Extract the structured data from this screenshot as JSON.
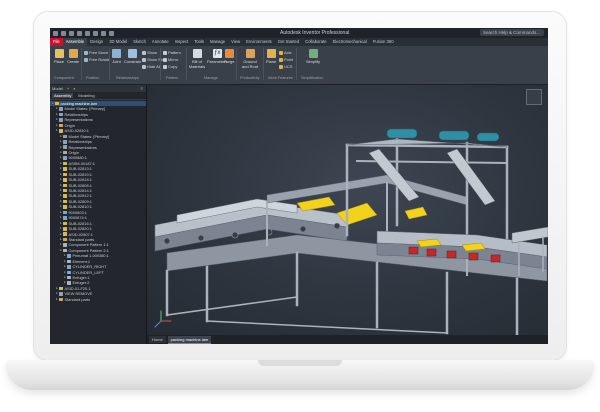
{
  "window": {
    "title": "Autodesk Inventor Professional",
    "search_placeholder": "Search Help & Commands..."
  },
  "tabs": [
    {
      "label": "File",
      "kind": "file"
    },
    {
      "label": "Assemble",
      "kind": "active"
    },
    {
      "label": "Design"
    },
    {
      "label": "3D Model"
    },
    {
      "label": "Sketch"
    },
    {
      "label": "Annotate"
    },
    {
      "label": "Inspect"
    },
    {
      "label": "Tools"
    },
    {
      "label": "Manage"
    },
    {
      "label": "View"
    },
    {
      "label": "Environments"
    },
    {
      "label": "Get Started"
    },
    {
      "label": "Collaborate"
    },
    {
      "label": "Electromechanical"
    },
    {
      "label": "Fusion 360"
    }
  ],
  "ribbon": {
    "buttons": {
      "place": "Place",
      "create": "Create",
      "joint": "Joint",
      "constrain": "Constrain",
      "bill_of_materials": "Bill of Materials",
      "parameters": "Parameters",
      "forge": "Forge",
      "ground_and_root": "Ground and Root",
      "plane": "Plane",
      "simplify": "Simplify"
    },
    "small": {
      "free_move": "Free Move",
      "free_rotate": "Free Rotate",
      "show": "Show",
      "show_sick": "Show Sick",
      "hide_all": "Hide All",
      "pattern": "Pattern",
      "mirror": "Mirror",
      "copy": "Copy",
      "axis": "Axis",
      "point": "Point",
      "ucs": "UCS"
    },
    "panels": {
      "component": "Component",
      "position": "Position",
      "relationships": "Relationships",
      "pattern": "Pattern",
      "manage": "Manage",
      "productivity": "Productivity",
      "work_features": "Work Features",
      "simplification": "Simplification"
    }
  },
  "browser": {
    "header": "Model",
    "tabs": [
      "Assembly",
      "Modeling"
    ],
    "items": [
      {
        "label": "packing machine.iam",
        "depth": 0,
        "sel": true,
        "c": "#d9b85c"
      },
      {
        "label": "Model States: [Primary]",
        "depth": 1,
        "c": "#8fa3b8"
      },
      {
        "label": "Relationships",
        "depth": 1,
        "c": "#8fa3b8"
      },
      {
        "label": "Representations",
        "depth": 1,
        "c": "#8fa3b8"
      },
      {
        "label": "Origin",
        "depth": 1,
        "c": "#c9a86a"
      },
      {
        "label": "ASID-02810:1",
        "depth": 1,
        "c": "#d9b85c"
      },
      {
        "label": "Model States: [Primary]",
        "depth": 2,
        "c": "#8fa3b8"
      },
      {
        "label": "Relationships",
        "depth": 2,
        "c": "#8fa3b8"
      },
      {
        "label": "Representations",
        "depth": 2,
        "c": "#8fa3b8"
      },
      {
        "label": "Origin",
        "depth": 2,
        "c": "#c9a86a"
      },
      {
        "label": "9000880:1",
        "depth": 2,
        "c": "#7aa7d8"
      },
      {
        "label": "ASSM-00187:1",
        "depth": 2,
        "c": "#d9b85c"
      },
      {
        "label": "SUB-02813:1",
        "depth": 2,
        "c": "#d9b85c"
      },
      {
        "label": "SUB-02819:1",
        "depth": 2,
        "c": "#d9b85c"
      },
      {
        "label": "SUB-02818:1",
        "depth": 2,
        "c": "#d9b85c"
      },
      {
        "label": "SUB-02808:1",
        "depth": 2,
        "c": "#d9b85c"
      },
      {
        "label": "SUB-02814:1",
        "depth": 2,
        "c": "#d9b85c"
      },
      {
        "label": "SUB-02812:1",
        "depth": 2,
        "c": "#d9b85c"
      },
      {
        "label": "SUB-02809:1",
        "depth": 2,
        "c": "#d9b85c"
      },
      {
        "label": "SUB-02810:1",
        "depth": 2,
        "c": "#d9b85c"
      },
      {
        "label": "9000803:1",
        "depth": 2,
        "c": "#7aa7d8"
      },
      {
        "label": "9000874:1",
        "depth": 2,
        "c": "#7aa7d8"
      },
      {
        "label": "SUB-02816:1",
        "depth": 2,
        "c": "#d9b85c"
      },
      {
        "label": "SUB-02820:1",
        "depth": 2,
        "c": "#d9b85c"
      },
      {
        "label": "ASID-02807:1",
        "depth": 2,
        "c": "#d9b85c"
      },
      {
        "label": "Standard parts",
        "depth": 2,
        "c": "#c9a86a"
      },
      {
        "label": "Component Pattern 1:1",
        "depth": 2,
        "c": "#a9b4c0"
      },
      {
        "label": "Component Pattern 2:1",
        "depth": 2,
        "c": "#a9b4c0"
      },
      {
        "label": "Pneumat 1-000380:1",
        "depth": 3,
        "c": "#7aa7d8"
      },
      {
        "label": "Element:1",
        "depth": 3,
        "c": "#a9b4c0"
      },
      {
        "label": "CYLINDER_RIGHT",
        "depth": 3,
        "c": "#7aa7d8"
      },
      {
        "label": "CYLINDER_LEFT",
        "depth": 3,
        "c": "#7aa7d8"
      },
      {
        "label": "Enfuger:1",
        "depth": 3,
        "c": "#a9b4c0"
      },
      {
        "label": "Enfuger:2",
        "depth": 3,
        "c": "#a9b4c0"
      },
      {
        "label": "ASID-01-F20-1",
        "depth": 1,
        "c": "#d9b85c"
      },
      {
        "label": "VIEW REMOVE",
        "depth": 1,
        "c": "#8fa3b8"
      },
      {
        "label": "Standard parts",
        "depth": 1,
        "c": "#c9a86a"
      }
    ]
  },
  "document_tabs": [
    {
      "label": "Home",
      "on": false
    },
    {
      "label": "packing machine.iam",
      "on": true
    }
  ],
  "colors": {
    "accent_file": "#c8102e",
    "selection": "#2d4f7a",
    "machine_frame": "#a9b2bd",
    "yellow_part": "#f2d21b",
    "red_part": "#c62828",
    "teal_part": "#2f8fa3"
  }
}
